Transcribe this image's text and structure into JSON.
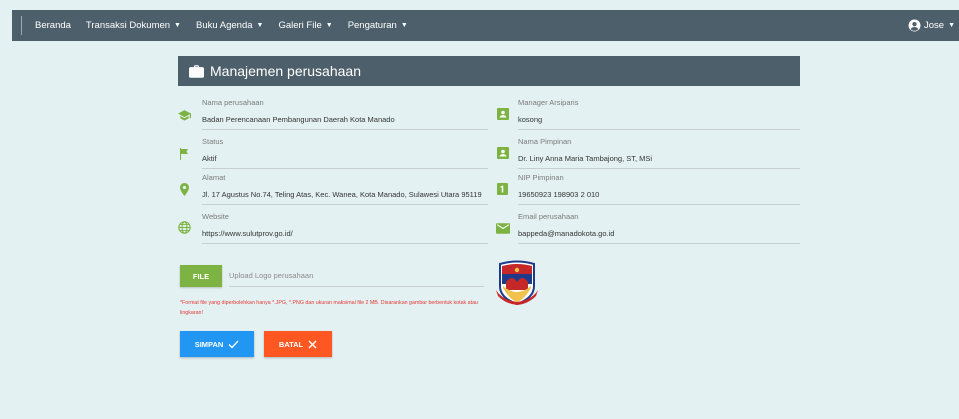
{
  "nav": {
    "items": [
      {
        "label": "Beranda",
        "caret": ""
      },
      {
        "label": "Transaksi Dokumen",
        "caret": "▼"
      },
      {
        "label": "Buku Agenda",
        "caret": "▼"
      },
      {
        "label": "Galeri File",
        "caret": "▼"
      },
      {
        "label": "Pengaturan",
        "caret": "▼"
      }
    ],
    "user": {
      "name": "Jose",
      "caret": "▼"
    }
  },
  "card": {
    "title": "Manajemen perusahaan",
    "icon": "briefcase-icon"
  },
  "fields_left": [
    {
      "label": "Nama perusahaan",
      "value": "Badan Perencanaan Pembangunan Daerah Kota Manado",
      "icon": "school-icon"
    },
    {
      "label": "Status",
      "value": "Aktif",
      "icon": "flag-icon"
    },
    {
      "label": "Alamat",
      "value": "Jl. 17 Agustus No.74, Teling Atas, Kec. Wanea, Kota Manado, Sulawesi Utara 95119",
      "icon": "location-pin-icon"
    },
    {
      "label": "Website",
      "value": "https://www.sulutprov.go.id/",
      "icon": "globe-icon"
    }
  ],
  "fields_right": [
    {
      "label": "Manager Arsiparis",
      "value": "kosong",
      "icon": "contact-card-icon"
    },
    {
      "label": "Nama Pimpinan",
      "value": "Dr. Liny Anna Maria Tambajong, ST, MSi",
      "icon": "contact-card-icon"
    },
    {
      "label": "NIP Pimpinan",
      "value": "19650923 198903 2 010",
      "icon": "id-number-icon"
    },
    {
      "label": "Email perusahaan",
      "value": "bappeda@manadokota.go.id",
      "icon": "email-icon"
    }
  ],
  "upload": {
    "button_label": "FILE",
    "placeholder": "Upload Logo perusahaan",
    "note": "*Format file yang diperbolehkan hanya *.JPG, *.PNG dan ukuran maksimal file 2 MB. Disarankan gambar berbentuk kotak atau lingkaran!"
  },
  "actions": {
    "save_label": "SIMPAN",
    "cancel_label": "BATAL"
  },
  "colors": {
    "navbar": "#4d5f6b",
    "page_bg": "#e4f1f2",
    "icon_green": "#7cb342",
    "save": "#2196f3",
    "cancel": "#ff5722",
    "note": "#e53935"
  }
}
